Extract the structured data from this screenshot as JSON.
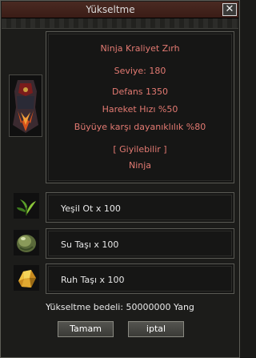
{
  "window": {
    "title": "Yükseltme",
    "close_label": "✕"
  },
  "item": {
    "name": "Ninja Kraliyet Zırh",
    "level": "Seviye: 180",
    "defense": "Defans 1350",
    "movement": "Hareket Hızı %50",
    "resistance": "Büyüye karşı dayanıklılık %80",
    "wearable": "[ Giyilebilir ]",
    "class": "Ninja",
    "icon": "armor-icon"
  },
  "materials": [
    {
      "label": "Yeşil Ot x 100",
      "icon": "herb-icon"
    },
    {
      "label": "Su Taşı x 100",
      "icon": "water-stone-icon"
    },
    {
      "label": "Ruh Taşı x 100",
      "icon": "soul-stone-icon"
    }
  ],
  "cost_text": "Yükseltme bedeli: 50000000 Yang",
  "buttons": {
    "ok": "Tamam",
    "cancel": "iptal"
  },
  "colors": {
    "stat_text": "#e37a72",
    "label_text": "#e8e8e8",
    "title_bar": "#3a1c16"
  }
}
